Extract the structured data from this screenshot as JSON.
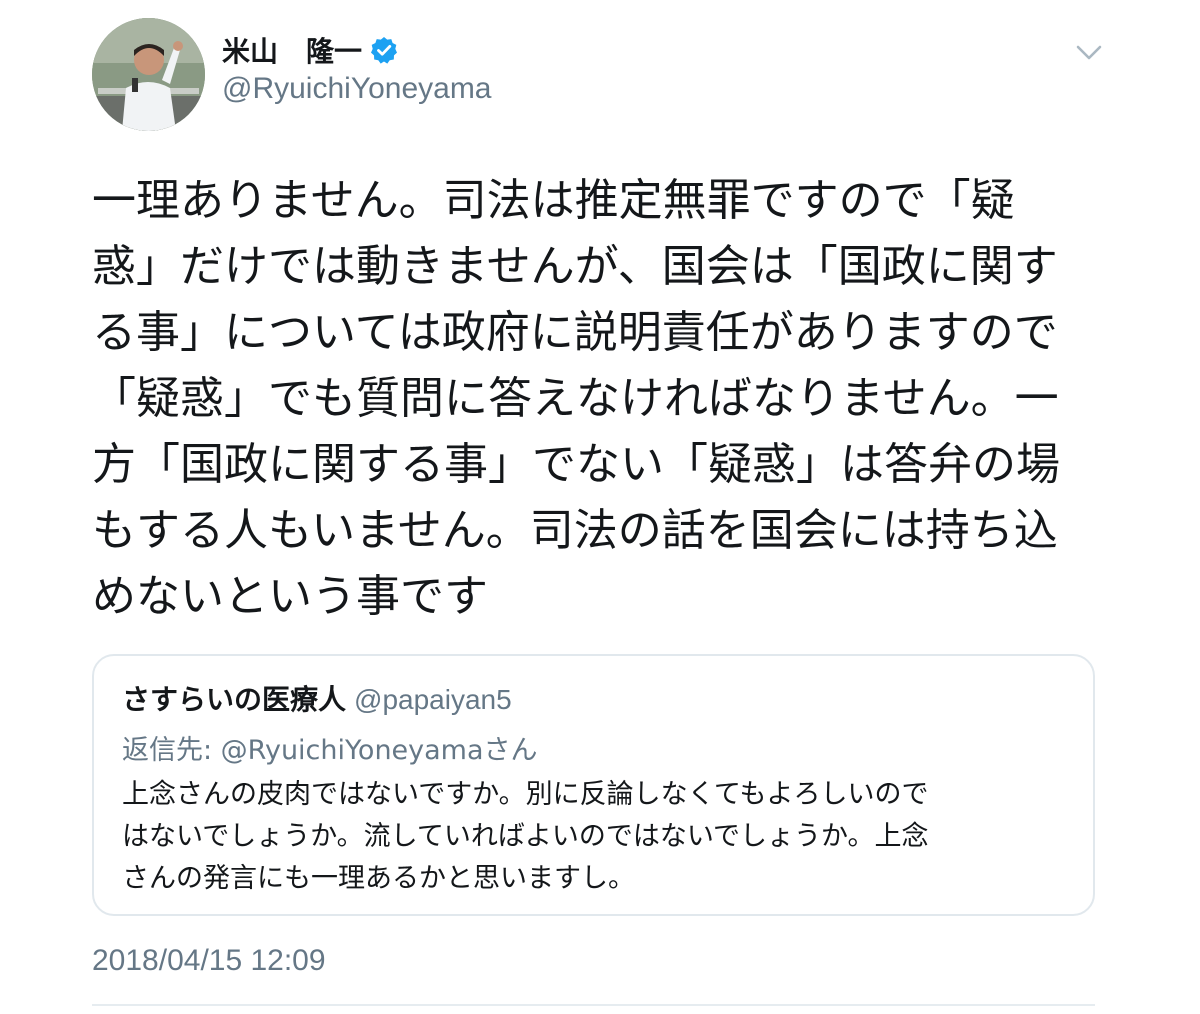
{
  "author": {
    "display_name": "米山　隆一",
    "handle": "@RyuichiYoneyama",
    "verified": true,
    "verified_color": "#1da1f2"
  },
  "menu_icon": "chevron-down-icon",
  "tweet": {
    "lines": [
      "一理ありません。司法は推定無罪ですので「疑",
      "惑」だけでは動きませんが、国会は「国政に関す",
      "る事」については政府に説明責任がありますので",
      "「疑惑」でも質問に答えなければなりません。一",
      "方「国政に関する事」でない「疑惑」は答弁の場",
      "もする人もいません。司法の話を国会には持ち込",
      "めないという事です"
    ]
  },
  "quoted_tweet": {
    "name": "さすらいの医療人",
    "handle": "@papaiyan5",
    "reply_to": "返信先: @RyuichiYoneyamaさん",
    "lines": [
      "上念さんの皮肉ではないですか。別に反論しなくてもよろしいので",
      "はないでしょうか。流していればよいのではないでしょうか。上念",
      "さんの発言にも一理あるかと思いますし。"
    ]
  },
  "timestamp": "2018/04/15 12:09",
  "colors": {
    "text": "#14171a",
    "secondary": "#657786",
    "border": "#e1e8ed"
  }
}
